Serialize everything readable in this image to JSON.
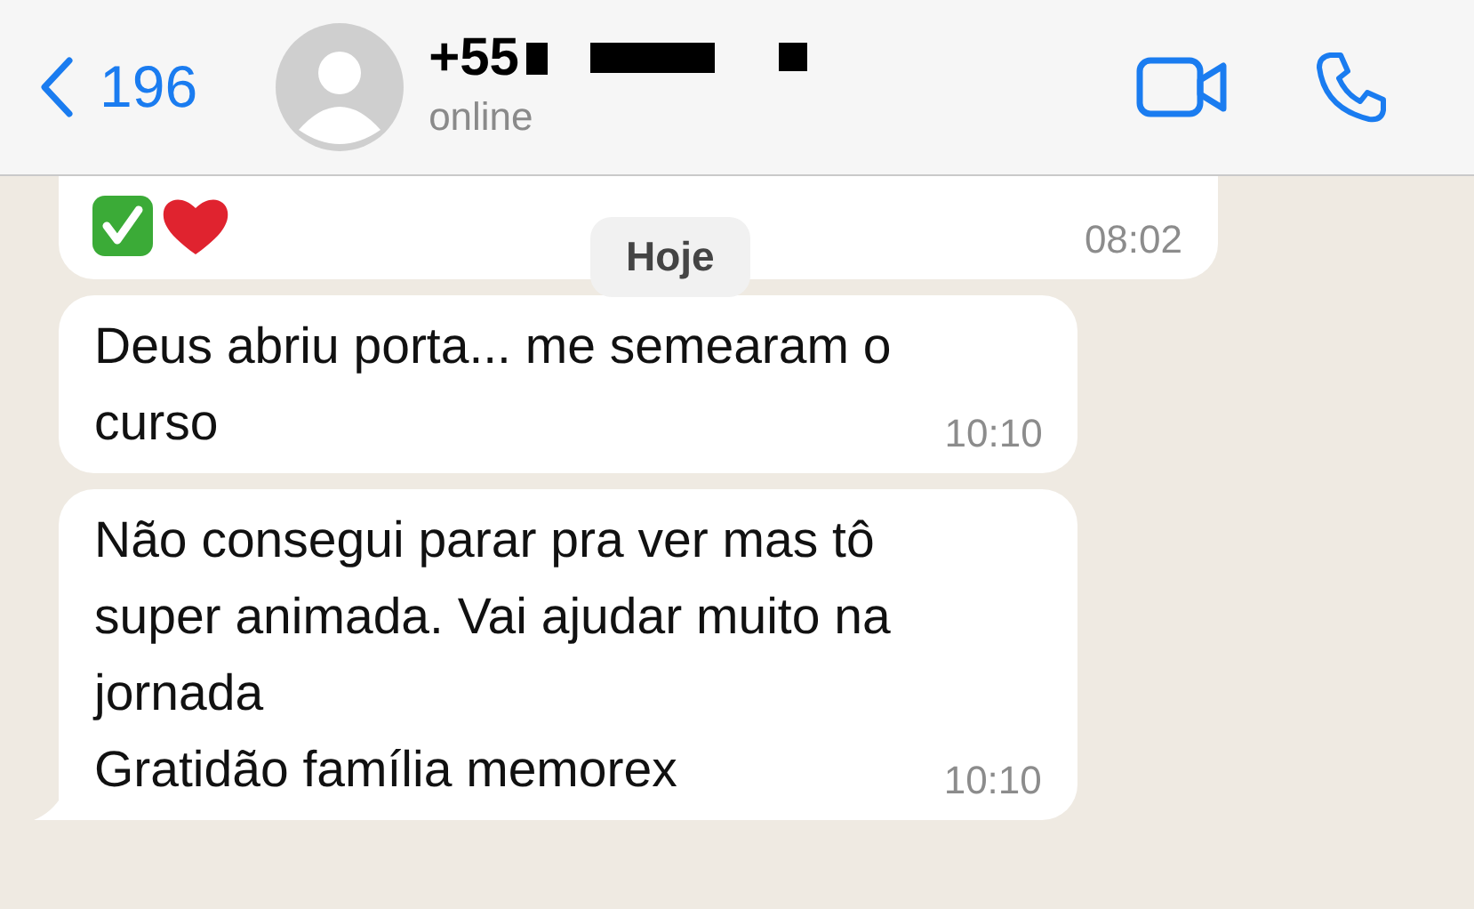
{
  "header": {
    "back_count": "196",
    "title": "+55",
    "status": "online"
  },
  "date_label": "Hoje",
  "messages": [
    {
      "kind": "emoji",
      "time": "08:02"
    },
    {
      "kind": "text",
      "text": "Deus abriu porta... me semearam o\ncurso",
      "time": "10:10",
      "tail": false
    },
    {
      "kind": "text",
      "text": "Não consegui parar pra ver mas tô\nsuper animada. Vai ajudar muito na\njornada\nGratidão família memorex",
      "time": "10:10",
      "tail": true
    }
  ]
}
